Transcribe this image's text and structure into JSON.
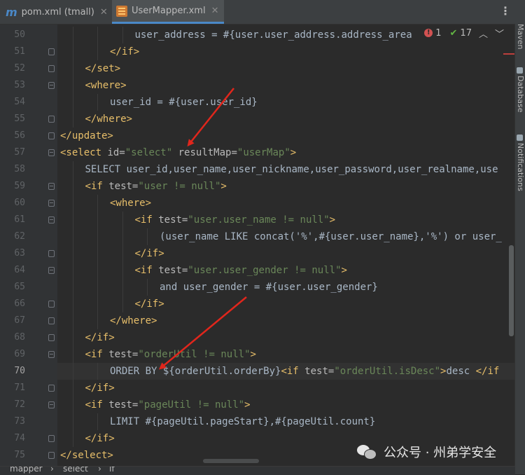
{
  "tabs": [
    {
      "label": "pom.xml (tmall)",
      "icon": "maven-m-icon"
    },
    {
      "label": "UserMapper.xml",
      "icon": "xml-file-icon",
      "active": true
    }
  ],
  "inspection": {
    "errors": "1",
    "warnings": "17"
  },
  "tool_windows": [
    "Maven",
    "Database",
    "Notifications"
  ],
  "editor": {
    "current_line": "70",
    "lines": [
      {
        "n": "50",
        "indent": 3,
        "tokens": [
          [
            "p",
            "user_address = #{user.user_address.address_area"
          ]
        ]
      },
      {
        "n": "51",
        "indent": 2,
        "tokens": [
          [
            "t",
            "</if>"
          ]
        ]
      },
      {
        "n": "52",
        "indent": 1,
        "tokens": [
          [
            "t",
            "</set>"
          ]
        ]
      },
      {
        "n": "53",
        "indent": 1,
        "tokens": [
          [
            "t",
            "<where>"
          ]
        ]
      },
      {
        "n": "54",
        "indent": 2,
        "tokens": [
          [
            "p",
            "user_id = #{user.user_id}"
          ]
        ]
      },
      {
        "n": "55",
        "indent": 1,
        "tokens": [
          [
            "t",
            "</where>"
          ]
        ]
      },
      {
        "n": "56",
        "indent": 0,
        "tokens": [
          [
            "t",
            "</update>"
          ]
        ]
      },
      {
        "n": "57",
        "indent": 0,
        "tokens": [
          [
            "t",
            "<select "
          ],
          [
            "a",
            "id="
          ],
          [
            "s",
            "\"select\""
          ],
          [
            "a",
            " resultMap="
          ],
          [
            "s",
            "\"userMap\""
          ],
          [
            "t",
            ">"
          ]
        ]
      },
      {
        "n": "58",
        "indent": 1,
        "tokens": [
          [
            "p",
            "SELECT user_id,user_name,user_nickname,user_password,user_realname,use"
          ]
        ]
      },
      {
        "n": "59",
        "indent": 1,
        "tokens": [
          [
            "t",
            "<if "
          ],
          [
            "a",
            "test="
          ],
          [
            "s",
            "\"user != null\""
          ],
          [
            "t",
            ">"
          ]
        ]
      },
      {
        "n": "60",
        "indent": 2,
        "tokens": [
          [
            "t",
            "<where>"
          ]
        ]
      },
      {
        "n": "61",
        "indent": 3,
        "tokens": [
          [
            "t",
            "<if "
          ],
          [
            "a",
            "test="
          ],
          [
            "s",
            "\"user.user_name != null\""
          ],
          [
            "t",
            ">"
          ]
        ]
      },
      {
        "n": "62",
        "indent": 4,
        "tokens": [
          [
            "p",
            "(user_name LIKE concat('%',#{user.user_name},'%') or user_"
          ]
        ]
      },
      {
        "n": "63",
        "indent": 3,
        "tokens": [
          [
            "t",
            "</if>"
          ]
        ]
      },
      {
        "n": "64",
        "indent": 3,
        "tokens": [
          [
            "t",
            "<if "
          ],
          [
            "a",
            "test="
          ],
          [
            "s",
            "\"user.user_gender != null\""
          ],
          [
            "t",
            ">"
          ]
        ]
      },
      {
        "n": "65",
        "indent": 4,
        "tokens": [
          [
            "p",
            "and user_gender = #{user.user_gender}"
          ]
        ]
      },
      {
        "n": "66",
        "indent": 3,
        "tokens": [
          [
            "t",
            "</if>"
          ]
        ]
      },
      {
        "n": "67",
        "indent": 2,
        "tokens": [
          [
            "t",
            "</where>"
          ]
        ]
      },
      {
        "n": "68",
        "indent": 1,
        "tokens": [
          [
            "t",
            "</if>"
          ]
        ]
      },
      {
        "n": "69",
        "indent": 1,
        "tokens": [
          [
            "t",
            "<if "
          ],
          [
            "a",
            "test="
          ],
          [
            "s",
            "\"orderUtil != null\""
          ],
          [
            "t",
            ">"
          ]
        ]
      },
      {
        "n": "70",
        "indent": 2,
        "tokens": [
          [
            "p",
            "ORDER BY ${orderUtil.orderBy}"
          ],
          [
            "t",
            "<if "
          ],
          [
            "a",
            "test="
          ],
          [
            "s",
            "\"orderUtil.isDesc\""
          ],
          [
            "t",
            ">"
          ],
          [
            "p",
            "desc "
          ],
          [
            "t",
            "</if"
          ]
        ]
      },
      {
        "n": "71",
        "indent": 1,
        "tokens": [
          [
            "t",
            "</if>"
          ]
        ]
      },
      {
        "n": "72",
        "indent": 1,
        "tokens": [
          [
            "t",
            "<if "
          ],
          [
            "a",
            "test="
          ],
          [
            "s",
            "\"pageUtil != null\""
          ],
          [
            "t",
            ">"
          ]
        ]
      },
      {
        "n": "73",
        "indent": 2,
        "tokens": [
          [
            "p",
            "LIMIT #{pageUtil.pageStart},#{pageUtil.count}"
          ]
        ]
      },
      {
        "n": "74",
        "indent": 1,
        "tokens": [
          [
            "t",
            "</if>"
          ]
        ]
      },
      {
        "n": "75",
        "indent": 0,
        "tokens": [
          [
            "t",
            "</select>"
          ]
        ]
      }
    ]
  },
  "breadcrumb": [
    "mapper",
    "select",
    "if"
  ],
  "watermark": "公众号 · 州弟学安全",
  "colors": {
    "background": "#2b2b2b",
    "tag": "#e8bf6a",
    "string": "#6a8759",
    "text": "#a9b7c6",
    "annotation_arrow": "#e0261c"
  }
}
